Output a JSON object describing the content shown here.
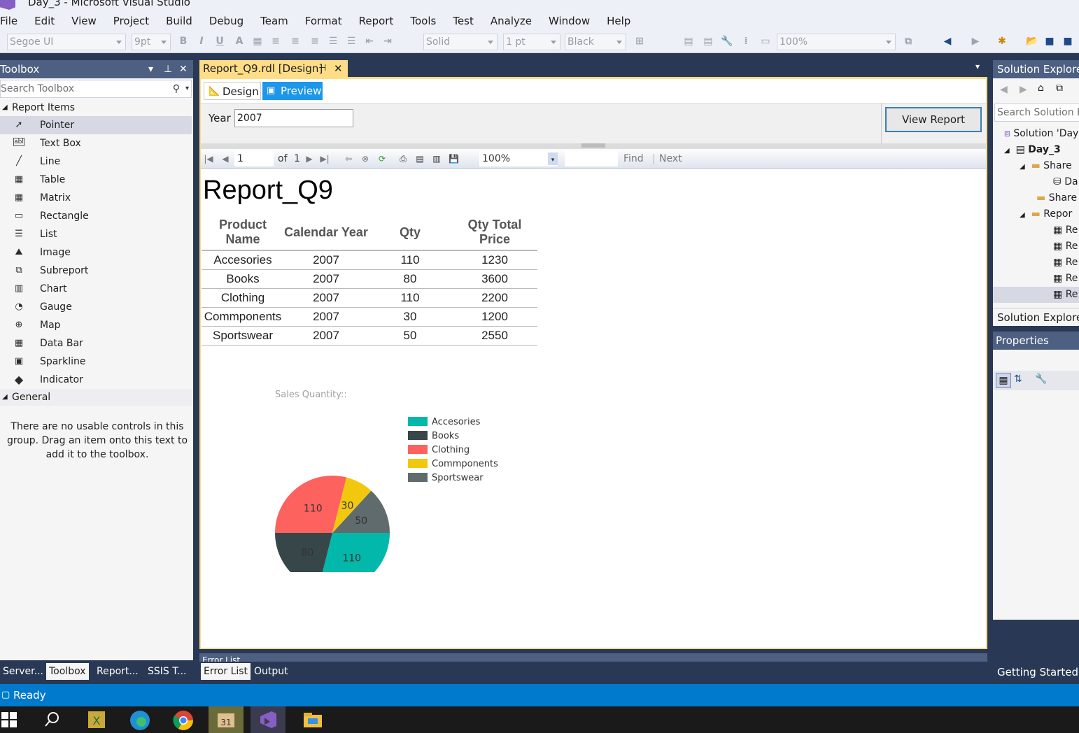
{
  "window": {
    "title": "Day_3 - Microsoft Visual Studio"
  },
  "menu": [
    "File",
    "Edit",
    "View",
    "Project",
    "Build",
    "Debug",
    "Team",
    "Format",
    "Report",
    "Tools",
    "Test",
    "Analyze",
    "Window",
    "Help"
  ],
  "toolbar": {
    "font": "Segoe UI",
    "size": "9pt",
    "border_style": "Solid",
    "border_width": "1 pt",
    "color": "Black",
    "zoom": "100%"
  },
  "toolbox": {
    "title": "Toolbox",
    "search_placeholder": "Search Toolbox",
    "section_report_items": "Report Items",
    "items": [
      {
        "label": "Pointer",
        "icon": "pointer-icon"
      },
      {
        "label": "Text Box",
        "icon": "textbox-icon"
      },
      {
        "label": "Line",
        "icon": "line-icon"
      },
      {
        "label": "Table",
        "icon": "table-icon"
      },
      {
        "label": "Matrix",
        "icon": "matrix-icon"
      },
      {
        "label": "Rectangle",
        "icon": "rectangle-icon"
      },
      {
        "label": "List",
        "icon": "list-icon"
      },
      {
        "label": "Image",
        "icon": "image-icon"
      },
      {
        "label": "Subreport",
        "icon": "subreport-icon"
      },
      {
        "label": "Chart",
        "icon": "chart-icon"
      },
      {
        "label": "Gauge",
        "icon": "gauge-icon"
      },
      {
        "label": "Map",
        "icon": "map-icon"
      },
      {
        "label": "Data Bar",
        "icon": "databar-icon"
      },
      {
        "label": "Sparkline",
        "icon": "sparkline-icon"
      },
      {
        "label": "Indicator",
        "icon": "indicator-icon"
      }
    ],
    "section_general": "General",
    "empty_text": "There are no usable controls in this group. Drag an item onto this text to add it to the toolbox."
  },
  "left_tabs": [
    "Server...",
    "Toolbox",
    "Report...",
    "SSIS T..."
  ],
  "document": {
    "tab_title": "Report_Q9.rdl [Design]",
    "design_tab": "Design",
    "preview_tab": "Preview",
    "param_label": "Year",
    "param_value": "2007",
    "view_report": "View Report",
    "page_current": "1",
    "page_of": "of",
    "page_total": "1",
    "zoom": "100%",
    "find": "Find",
    "next": "Next"
  },
  "report": {
    "title": "Report_Q9",
    "columns": [
      "Product Name",
      "Calendar Year",
      "Qty",
      "Qty Total Price"
    ],
    "rows": [
      [
        "Accesories",
        "2007",
        "110",
        "1230"
      ],
      [
        "Books",
        "2007",
        "80",
        "3600"
      ],
      [
        "Clothing",
        "2007",
        "110",
        "2200"
      ],
      [
        "Commponents",
        "2007",
        "30",
        "1200"
      ],
      [
        "Sportswear",
        "2007",
        "50",
        "2550"
      ]
    ]
  },
  "chart_data": {
    "type": "pie",
    "title": "Sales Quantity::",
    "categories": [
      "Accesories",
      "Books",
      "Clothing",
      "Commponents",
      "Sportswear"
    ],
    "values": [
      110,
      80,
      110,
      30,
      50
    ],
    "colors": [
      "#01b8aa",
      "#374649",
      "#fd625e",
      "#f2c80f",
      "#5f6b6d"
    ],
    "legend": "right"
  },
  "solution_explorer": {
    "title": "Solution Explorer",
    "search_placeholder": "Search Solution Ex",
    "rows": [
      "Solution 'Day",
      "Day_3",
      "Share",
      "Da",
      "Share",
      "Repor",
      "Re",
      "Re",
      "Re",
      "Re",
      "Re"
    ],
    "bottom_tab": "Solution Explorer"
  },
  "properties": {
    "title": "Properties"
  },
  "getting_started": "Getting Started (S",
  "bottom_tabs": [
    "Error List",
    "Output"
  ],
  "error_list_title": "Error List",
  "status": "Ready"
}
